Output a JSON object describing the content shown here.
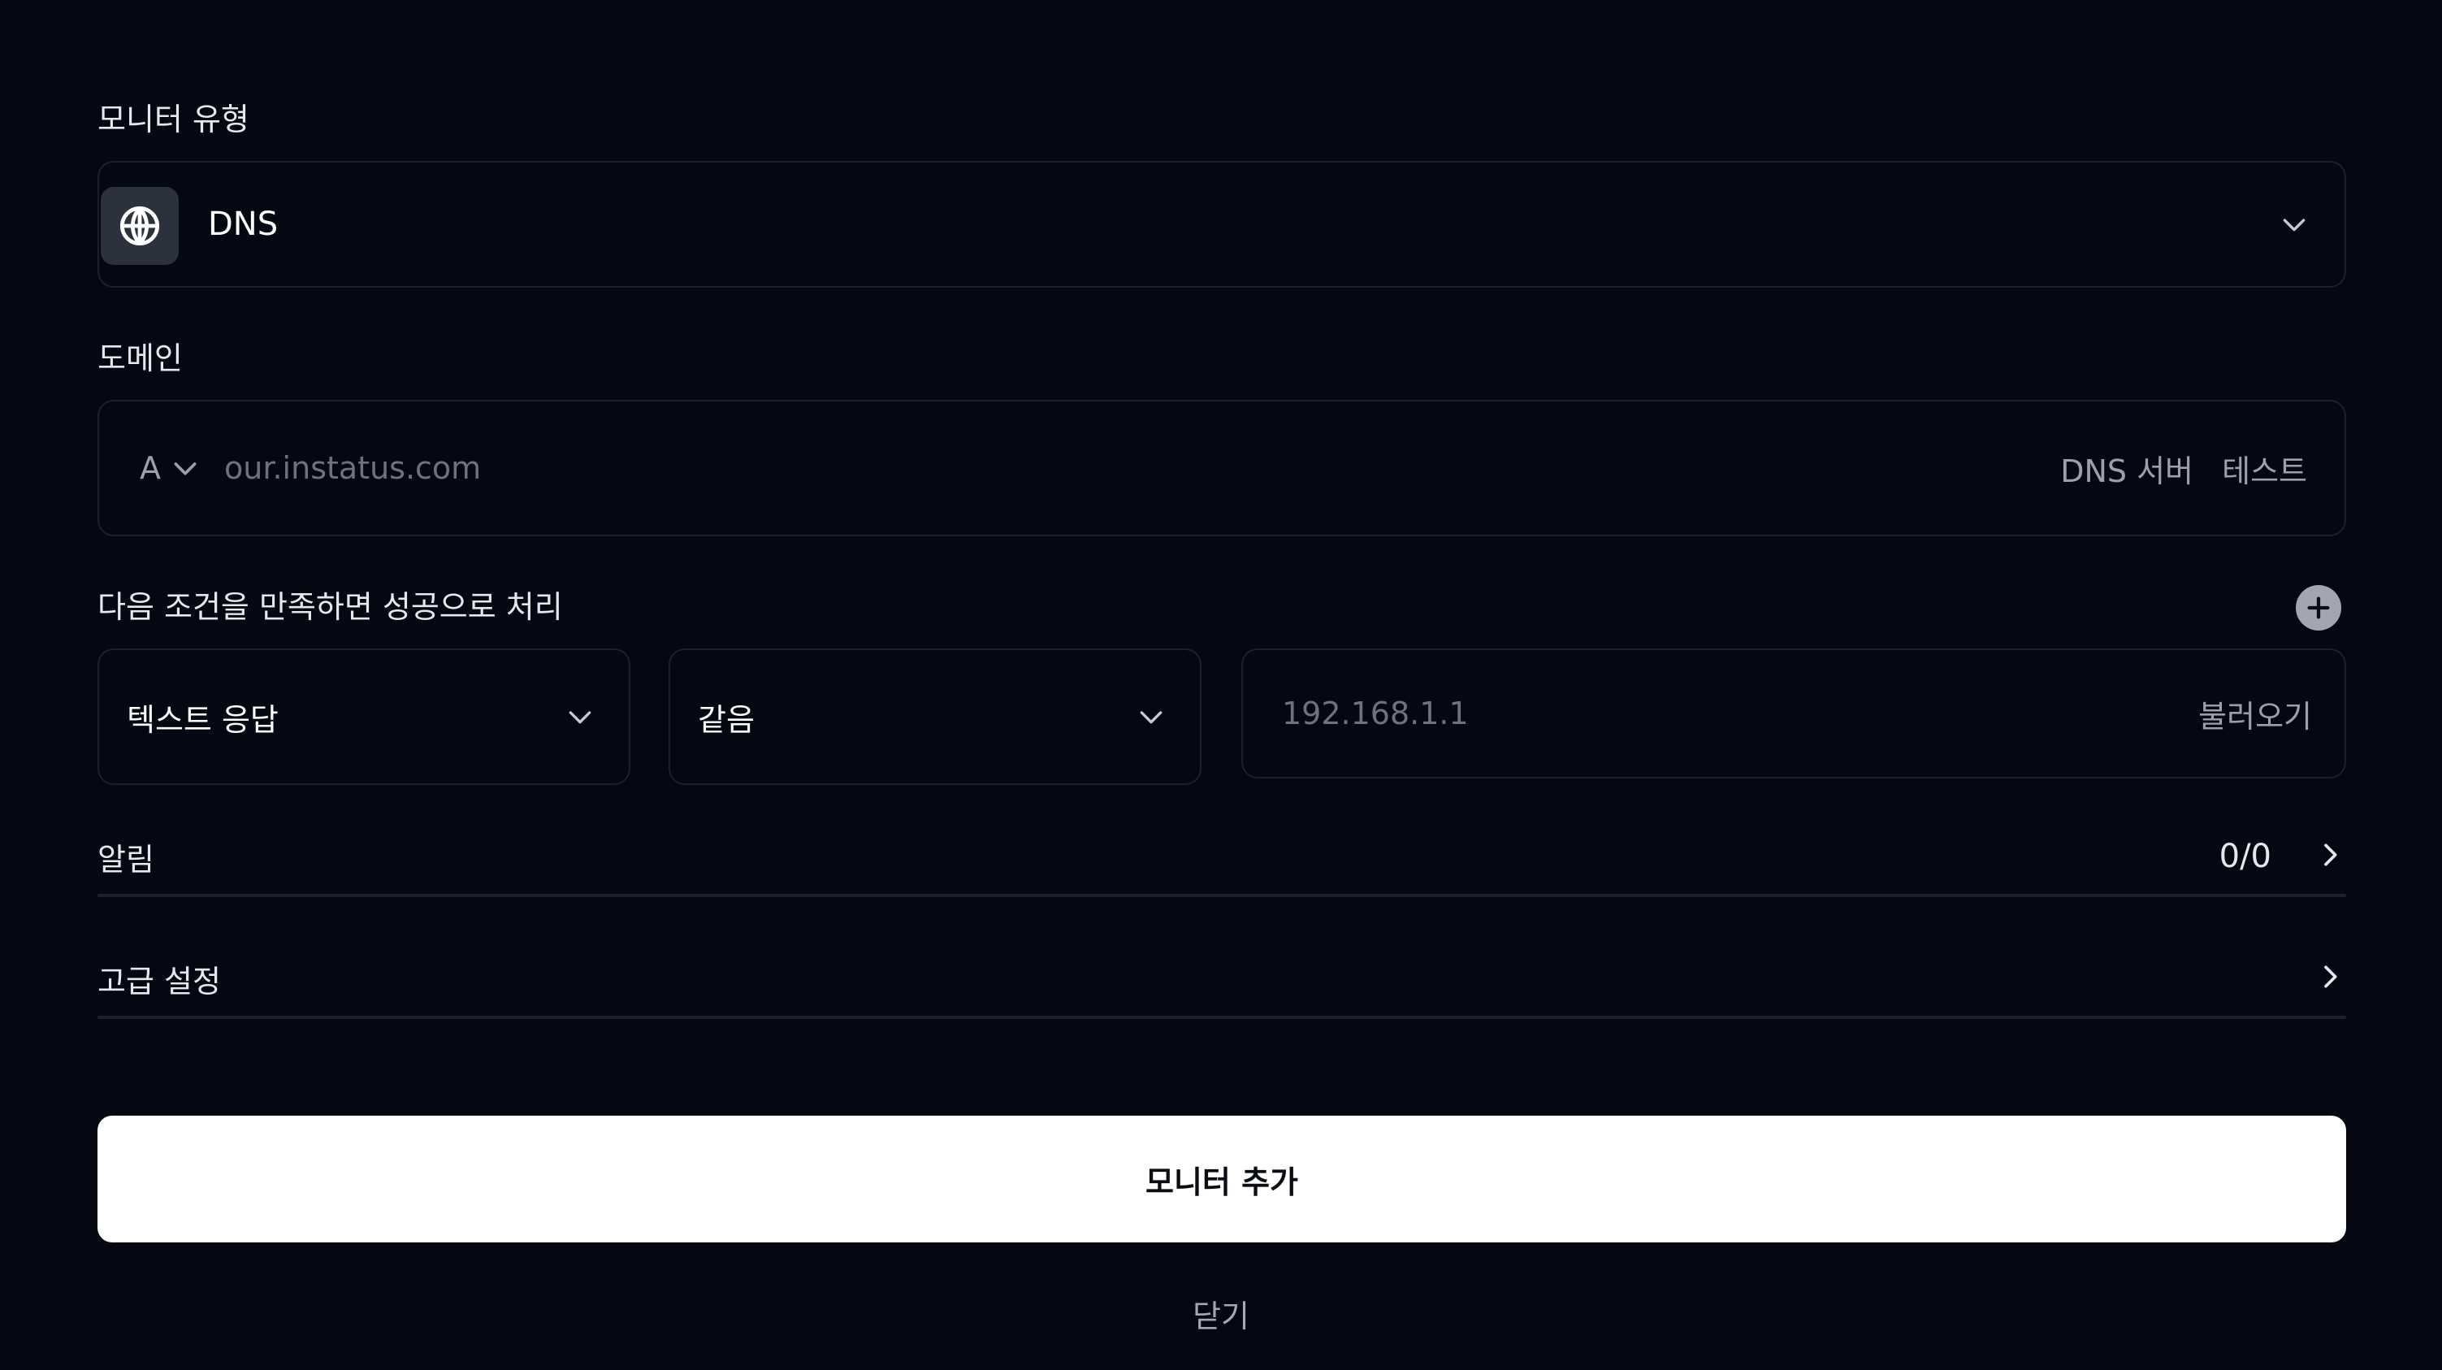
{
  "colors": {
    "background": "#050812",
    "border": "#1c202b",
    "muted_text": "#9aa1ad",
    "placeholder": "#6c7280",
    "primary_button_bg": "#ffffff",
    "primary_button_text": "#0b0d14",
    "icon_tile": "#2b313d"
  },
  "monitor_type": {
    "label": "모니터 유형",
    "selected": "DNS",
    "icon": "globe-icon"
  },
  "domain": {
    "label": "도메인",
    "record_type": "A",
    "value": "",
    "placeholder": "our.instatus.com",
    "dns_server_label": "DNS 서버",
    "test_label": "테스트"
  },
  "condition": {
    "label": "다음 조건을 만족하면 성공으로 처리",
    "add_icon": "plus-icon",
    "source": "텍스트 응답",
    "operator": "같음",
    "value": "",
    "placeholder": "192.168.1.1",
    "load_label": "불러오기"
  },
  "alerts": {
    "label": "알림",
    "active": "0",
    "separator": "/",
    "total": "0"
  },
  "advanced": {
    "label": "고급 설정"
  },
  "actions": {
    "submit_label": "모니터 추가",
    "close_label": "닫기"
  }
}
